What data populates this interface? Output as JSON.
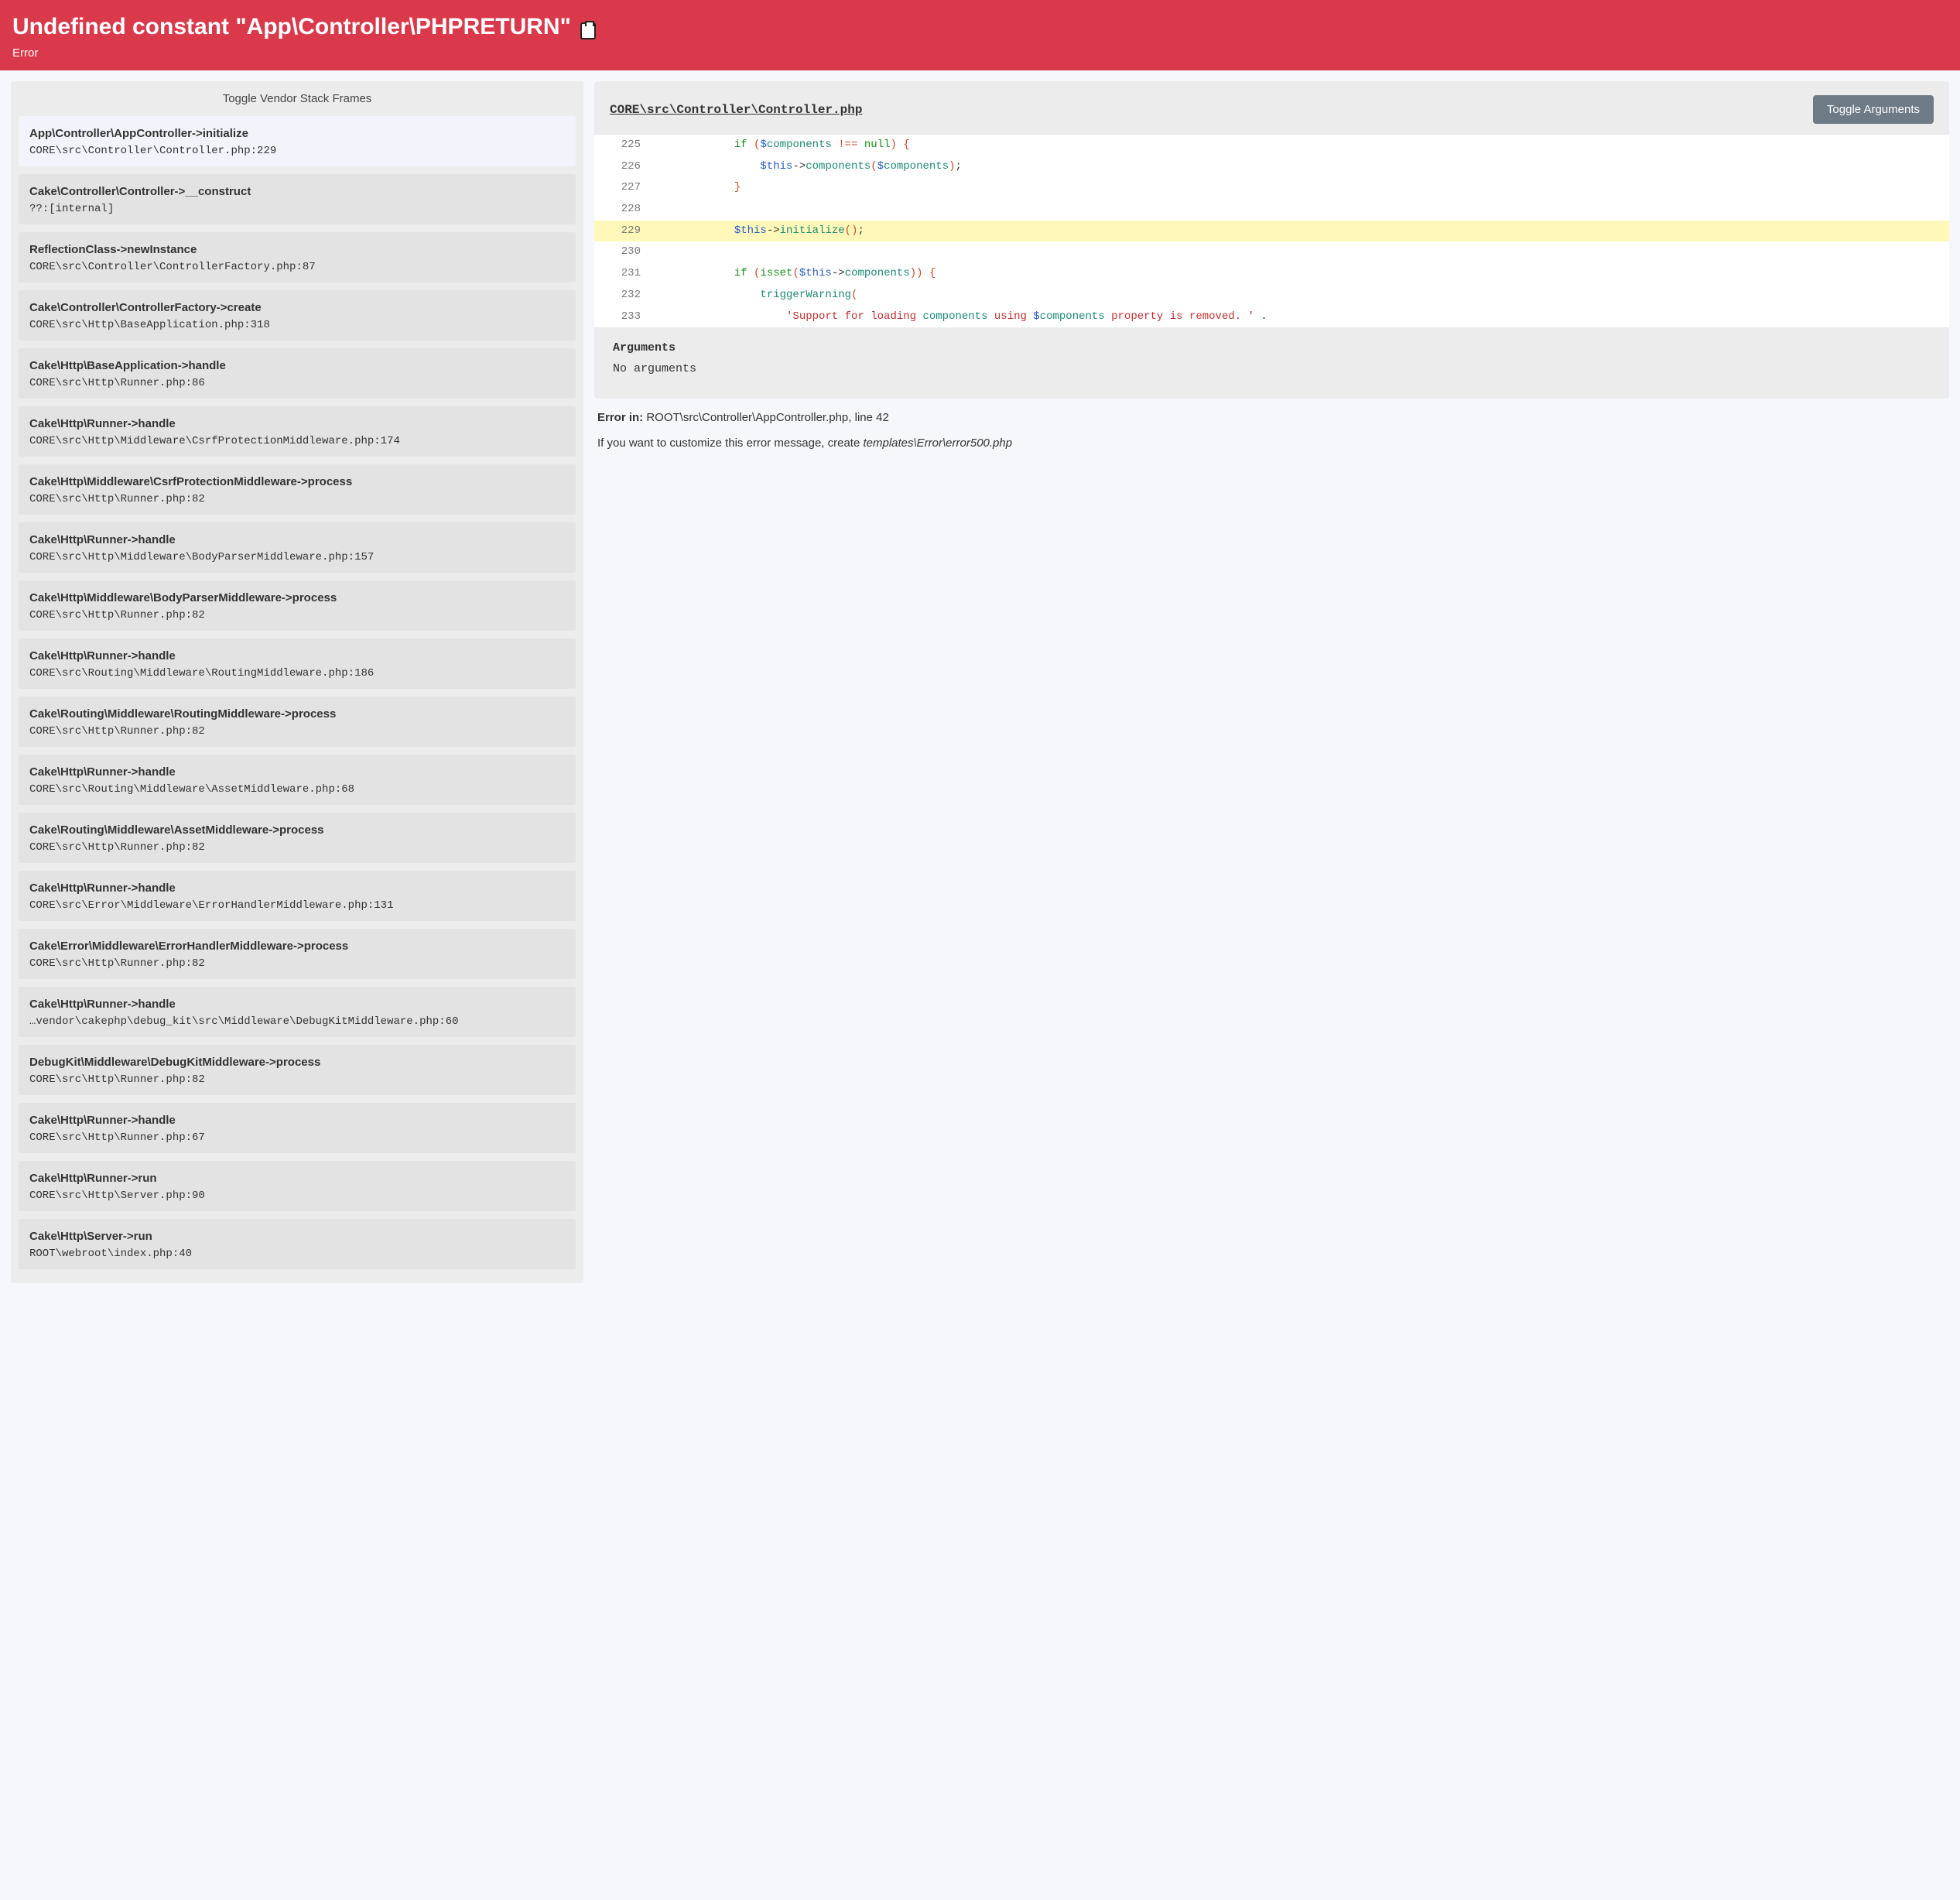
{
  "header": {
    "title": "Undefined constant \"App\\Controller\\PHPRETURN\"",
    "subtitle": "Error"
  },
  "sidebar": {
    "toggle_label": "Toggle Vendor Stack Frames",
    "frames": [
      {
        "title": "App\\Controller\\AppController->initialize",
        "file": "CORE\\src\\Controller\\Controller.php:229",
        "active": true
      },
      {
        "title": "Cake\\Controller\\Controller->__construct",
        "file": "??:[internal]"
      },
      {
        "title": "ReflectionClass->newInstance",
        "file": "CORE\\src\\Controller\\ControllerFactory.php:87"
      },
      {
        "title": "Cake\\Controller\\ControllerFactory->create",
        "file": "CORE\\src\\Http\\BaseApplication.php:318"
      },
      {
        "title": "Cake\\Http\\BaseApplication->handle",
        "file": "CORE\\src\\Http\\Runner.php:86"
      },
      {
        "title": "Cake\\Http\\Runner->handle",
        "file": "CORE\\src\\Http\\Middleware\\CsrfProtectionMiddleware.php:174"
      },
      {
        "title": "Cake\\Http\\Middleware\\CsrfProtectionMiddleware->process",
        "file": "CORE\\src\\Http\\Runner.php:82"
      },
      {
        "title": "Cake\\Http\\Runner->handle",
        "file": "CORE\\src\\Http\\Middleware\\BodyParserMiddleware.php:157"
      },
      {
        "title": "Cake\\Http\\Middleware\\BodyParserMiddleware->process",
        "file": "CORE\\src\\Http\\Runner.php:82"
      },
      {
        "title": "Cake\\Http\\Runner->handle",
        "file": "CORE\\src\\Routing\\Middleware\\RoutingMiddleware.php:186"
      },
      {
        "title": "Cake\\Routing\\Middleware\\RoutingMiddleware->process",
        "file": "CORE\\src\\Http\\Runner.php:82"
      },
      {
        "title": "Cake\\Http\\Runner->handle",
        "file": "CORE\\src\\Routing\\Middleware\\AssetMiddleware.php:68"
      },
      {
        "title": "Cake\\Routing\\Middleware\\AssetMiddleware->process",
        "file": "CORE\\src\\Http\\Runner.php:82"
      },
      {
        "title": "Cake\\Http\\Runner->handle",
        "file": "CORE\\src\\Error\\Middleware\\ErrorHandlerMiddleware.php:131"
      },
      {
        "title": "Cake\\Error\\Middleware\\ErrorHandlerMiddleware->process",
        "file": "CORE\\src\\Http\\Runner.php:82"
      },
      {
        "title": "Cake\\Http\\Runner->handle",
        "file": "…vendor\\cakephp\\debug_kit\\src\\Middleware\\DebugKitMiddleware.php:60"
      },
      {
        "title": "DebugKit\\Middleware\\DebugKitMiddleware->process",
        "file": "CORE\\src\\Http\\Runner.php:82"
      },
      {
        "title": "Cake\\Http\\Runner->handle",
        "file": "CORE\\src\\Http\\Runner.php:67"
      },
      {
        "title": "Cake\\Http\\Runner->run",
        "file": "CORE\\src\\Http\\Server.php:90"
      },
      {
        "title": "Cake\\Http\\Server->run",
        "file": "ROOT\\webroot\\index.php:40"
      }
    ]
  },
  "main": {
    "file_title": "CORE\\src\\Controller\\Controller.php",
    "toggle_args": "Toggle Arguments",
    "args_heading": "Arguments",
    "args_content": "No arguments",
    "error_in_label": "Error in: ",
    "error_in_value": "ROOT\\src\\Controller\\AppController.php, line 42",
    "customize_pre": "If you want to customize this error message, create ",
    "customize_path": "templates\\Error\\error500.php",
    "code": {
      "lines": [
        225,
        226,
        227,
        228,
        229,
        230,
        231,
        232,
        233
      ],
      "hl": 229,
      "text": {
        "225": "            if ($components !== null) {",
        "226": "                $this->components($components);",
        "227": "            }",
        "228": "",
        "229": "            $this->initialize();",
        "230": "",
        "231": "            if (isset($this->components)) {",
        "232": "                triggerWarning(",
        "233": "                    'Support for loading components using $components property is removed. ' ."
      }
    }
  }
}
